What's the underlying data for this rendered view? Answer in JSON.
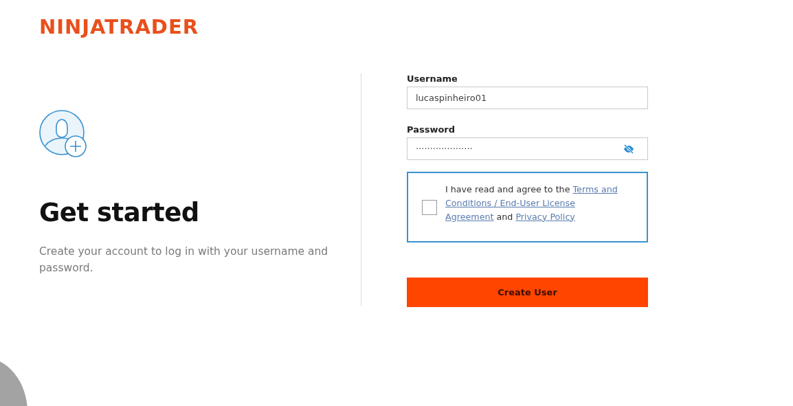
{
  "logo": {
    "text": "NINJATRADER"
  },
  "intro": {
    "title": "Get started",
    "description": "Create your account to log in with your username and password."
  },
  "form": {
    "username": {
      "label": "Username",
      "value": "lucaspinheiro01"
    },
    "password": {
      "label": "Password",
      "value": "····················",
      "visible": false
    },
    "consent": {
      "checked": false,
      "lines": [
        [
          {
            "kind": "text",
            "text": "I have read and agree to the "
          },
          {
            "kind": "link",
            "text": "Terms and"
          }
        ],
        [
          {
            "kind": "link",
            "text": "Conditions / End-User License"
          }
        ],
        [
          {
            "kind": "link",
            "text": "Agreement"
          },
          {
            "kind": "text",
            "text": " and "
          },
          {
            "kind": "link",
            "text": "Privacy Policy"
          }
        ]
      ]
    },
    "submit": {
      "label": "Create User"
    }
  }
}
